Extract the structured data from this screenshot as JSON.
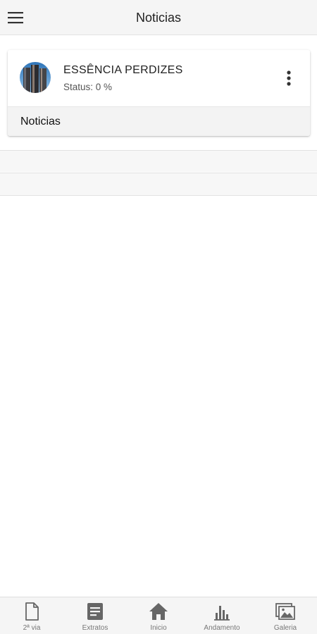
{
  "header": {
    "title": "Noticias",
    "menu_icon": "hamburger-menu-icon"
  },
  "project": {
    "name": "ESSÊNCIA PERDIZES",
    "status": "Status: 0 %",
    "avatar_icon": "building-thumbnail",
    "more_icon": "more-vertical-icon"
  },
  "section": {
    "label": "Noticias"
  },
  "bottom_nav": {
    "items": [
      {
        "label": "2ª via",
        "icon": "document-icon"
      },
      {
        "label": "Extratos",
        "icon": "statement-icon"
      },
      {
        "label": "Inicio",
        "icon": "home-icon"
      },
      {
        "label": "Andamento",
        "icon": "bar-chart-icon"
      },
      {
        "label": "Galeria",
        "icon": "gallery-icon"
      }
    ]
  },
  "colors": {
    "header_bg": "#f5f5f5",
    "icon_gray": "#666666",
    "text_dark": "#222222"
  }
}
